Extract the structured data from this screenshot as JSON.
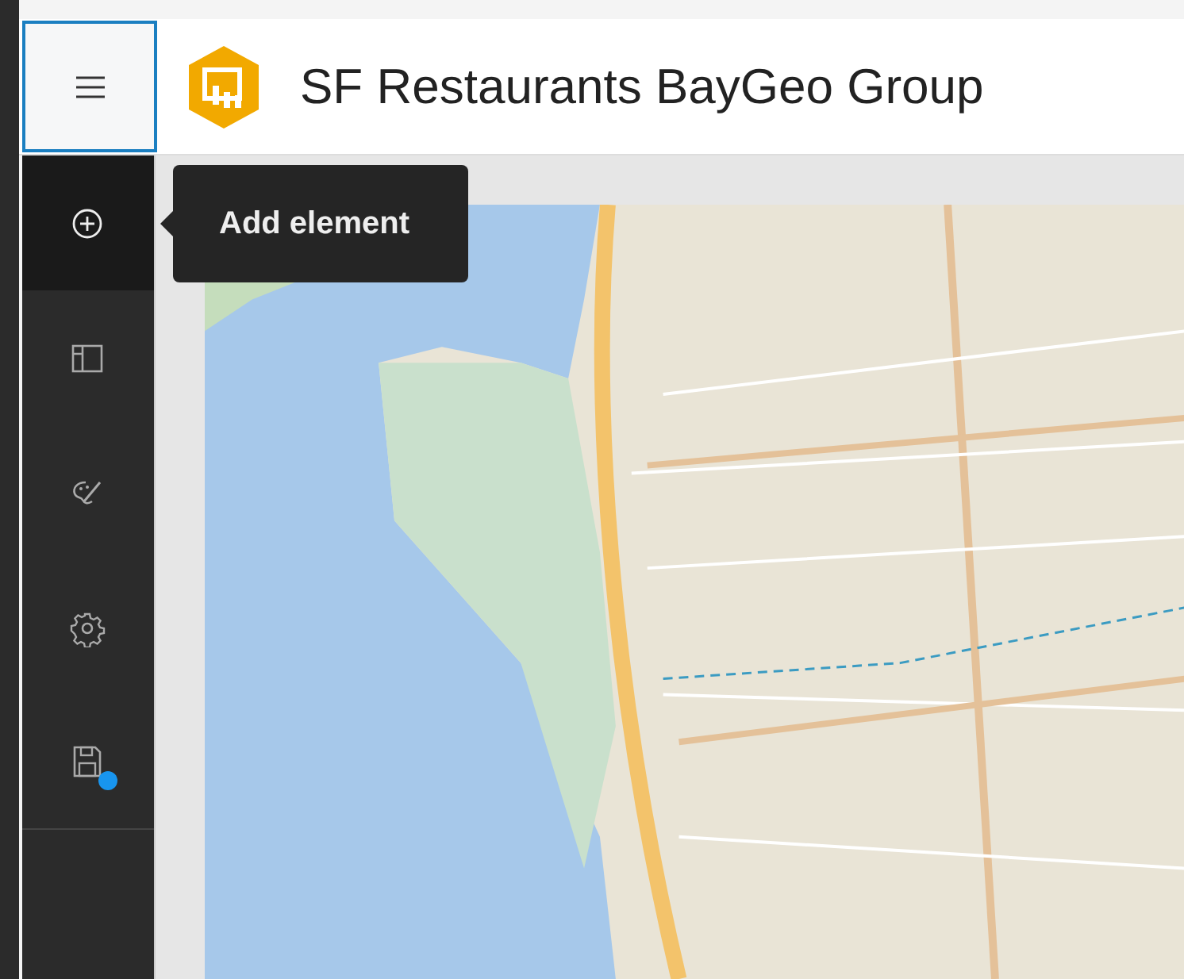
{
  "header": {
    "title": "SF Restaurants BayGeo Group"
  },
  "sidebar": {
    "items": [
      {
        "kind": "add",
        "selected": true
      },
      {
        "kind": "layout",
        "selected": false
      },
      {
        "kind": "theme",
        "selected": false
      },
      {
        "kind": "settings",
        "selected": false
      },
      {
        "kind": "save",
        "selected": false,
        "unsaved": true
      }
    ]
  },
  "tooltip": {
    "text": "Add element"
  }
}
